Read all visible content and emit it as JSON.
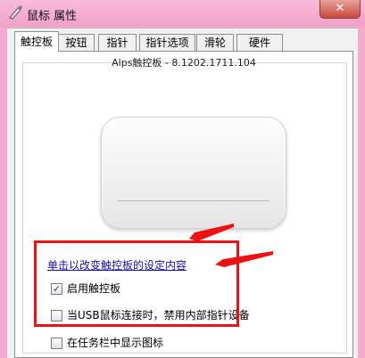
{
  "window": {
    "title": "鼠标 属性",
    "close_label": "✕"
  },
  "tabs": [
    {
      "label": "触控板",
      "active": true
    },
    {
      "label": "按钮",
      "active": false
    },
    {
      "label": "指针",
      "active": false
    },
    {
      "label": "指针选项",
      "active": false
    },
    {
      "label": "滑轮",
      "active": false
    },
    {
      "label": "硬件",
      "active": false
    }
  ],
  "panel": {
    "version": "Alps触控板 - 8.1202.1711.104",
    "settings_link": "单击以改变触控板的设定内容",
    "options": [
      {
        "label": "启用触控板",
        "checked": true
      },
      {
        "label": "当USB鼠标连接时，禁用内部指针设备",
        "checked": false
      },
      {
        "label": "在任务栏中显示图标",
        "checked": false
      }
    ]
  },
  "annotation": {
    "color": "#ee1111"
  }
}
